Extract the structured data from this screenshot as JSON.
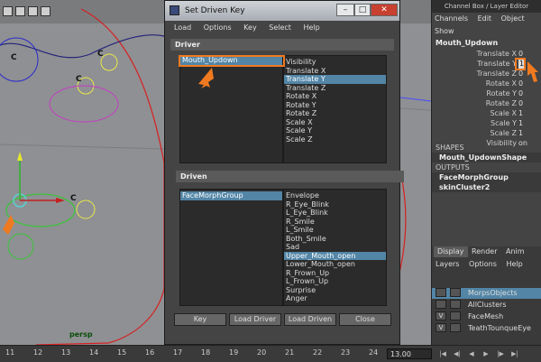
{
  "viewport": {
    "label": "persp",
    "curve_labels": [
      "C",
      "C",
      "C",
      "C"
    ]
  },
  "timeline": {
    "ticks": [
      "11",
      "12",
      "13",
      "14",
      "15",
      "16",
      "17",
      "18",
      "19",
      "20",
      "21",
      "22",
      "23",
      "24"
    ],
    "current_frame": "13.00"
  },
  "dialog": {
    "title": "Set Driven Key",
    "menu": [
      "Load",
      "Options",
      "Key",
      "Select",
      "Help"
    ],
    "driver_header": "Driver",
    "driver_objects": [
      "Mouth_Updown"
    ],
    "driver_attributes": [
      "Visibility",
      "Translate X",
      "Translate Y",
      "Translate Z",
      "Rotate X",
      "Rotate Y",
      "Rotate Z",
      "Scale X",
      "Scale Y",
      "Scale Z"
    ],
    "driver_selected_attribute": 2,
    "driven_header": "Driven",
    "driven_objects": [
      "FaceMorphGroup"
    ],
    "driven_attributes": [
      "Envelope",
      "R_Eye_Blink",
      "L_Eye_Blink",
      "R_Smile",
      "L_Smile",
      "Both_Smile",
      "Sad",
      "Upper_Mouth_open",
      "Lower_Mouth_open",
      "R_Frown_Up",
      "L_Frown_Up",
      "Surprise",
      "Anger"
    ],
    "driven_selected_attribute": 7,
    "buttons": {
      "key": "Key",
      "load_driver": "Load Driver",
      "load_driven": "Load Driven",
      "close": "Close"
    }
  },
  "channel_box": {
    "title": "Channel Box / Layer Editor",
    "menu": [
      "Channels",
      "Edit",
      "Object",
      "Show"
    ],
    "object_name": "Mouth_Updown",
    "attributes": [
      {
        "name": "Translate X",
        "value": "0"
      },
      {
        "name": "Translate Y",
        "value": "1"
      },
      {
        "name": "Translate Z",
        "value": "0"
      },
      {
        "name": "Rotate X",
        "value": "0"
      },
      {
        "name": "Rotate Y",
        "value": "0"
      },
      {
        "name": "Rotate Z",
        "value": "0"
      },
      {
        "name": "Scale X",
        "value": "1"
      },
      {
        "name": "Scale Y",
        "value": "1"
      },
      {
        "name": "Scale Z",
        "value": "1"
      },
      {
        "name": "Visibility",
        "value": "on"
      }
    ],
    "shapes_header": "SHAPES",
    "shape_name": "Mouth_UpdownShape",
    "outputs_header": "OUTPUTS",
    "outputs": [
      "FaceMorphGroup",
      "skinCluster2"
    ]
  },
  "layer_editor": {
    "tabs": [
      "Display",
      "Render",
      "Anim"
    ],
    "menu": [
      "Layers",
      "Options",
      "Help"
    ],
    "layers": [
      {
        "visible": "",
        "name": "MorpsObjects"
      },
      {
        "visible": "",
        "name": "AllClusters"
      },
      {
        "visible": "V",
        "name": "FaceMesh"
      },
      {
        "visible": "V",
        "name": "TeathTounqueEye"
      }
    ]
  },
  "colors": {
    "accent_orange": "#f07a20",
    "selection_blue": "#5285a6"
  }
}
